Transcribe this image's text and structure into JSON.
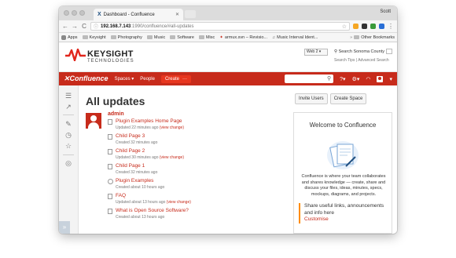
{
  "browser": {
    "tab_title": "Dashboard - Confluence",
    "profile": "Scott",
    "url_host": "192.168.7.143",
    "url_path": ":1990/confluence/#all-updates",
    "bookmarks": [
      "Apps",
      "Keysight",
      "Photography",
      "Music",
      "Software",
      "Misc",
      "armux.svn – Revisio...",
      "Music Interval Ident..."
    ],
    "other_bookmarks": "Other Bookmarks"
  },
  "keysight": {
    "name": "KEYSIGHT",
    "sub": "TECHNOLOGIES",
    "select_value": "Web 2",
    "search_label": "Search Sonoma County",
    "search_tips": "Search Tips",
    "advanced_search": "Advanced Search",
    "colors": {
      "wave": "#e1261c"
    }
  },
  "confluence_header": {
    "brand": "Confluence",
    "spaces": "Spaces",
    "people": "People",
    "create": "Create",
    "more": "···",
    "color": "#c72b1b"
  },
  "main": {
    "title": "All updates",
    "user": "admin",
    "entries": [
      {
        "title": "Plugin Examples Home Page",
        "meta": "Updated 22 minutes ago",
        "view_change": "(view change)"
      },
      {
        "title": "Child Page 3",
        "meta": "Created 32 minutes ago",
        "view_change": ""
      },
      {
        "title": "Child Page 2",
        "meta": "Updated 30 minutes ago",
        "view_change": "(view change)"
      },
      {
        "title": "Child Page 1",
        "meta": "Created 32 minutes ago",
        "view_change": ""
      },
      {
        "title": "Plugin Examples",
        "meta": "Created about 10 hours ago",
        "view_change": ""
      },
      {
        "title": "FAQ",
        "meta": "Updated about 13 hours ago",
        "view_change": "(view change)"
      },
      {
        "title": "What is Open Source Software?",
        "meta": "Created about 13 hours ago",
        "view_change": ""
      }
    ]
  },
  "sidebar": {
    "invite_users": "Invite Users",
    "create_space": "Create Space",
    "welcome_title": "Welcome to Confluence",
    "welcome_desc": "Confluence is where your team collaborates and shares knowledge — create, share and discuss your files, ideas, minutes, specs, mockups, diagrams, and projects.",
    "share_text": "Share useful links, announcements and info here",
    "customise": "Customise"
  }
}
